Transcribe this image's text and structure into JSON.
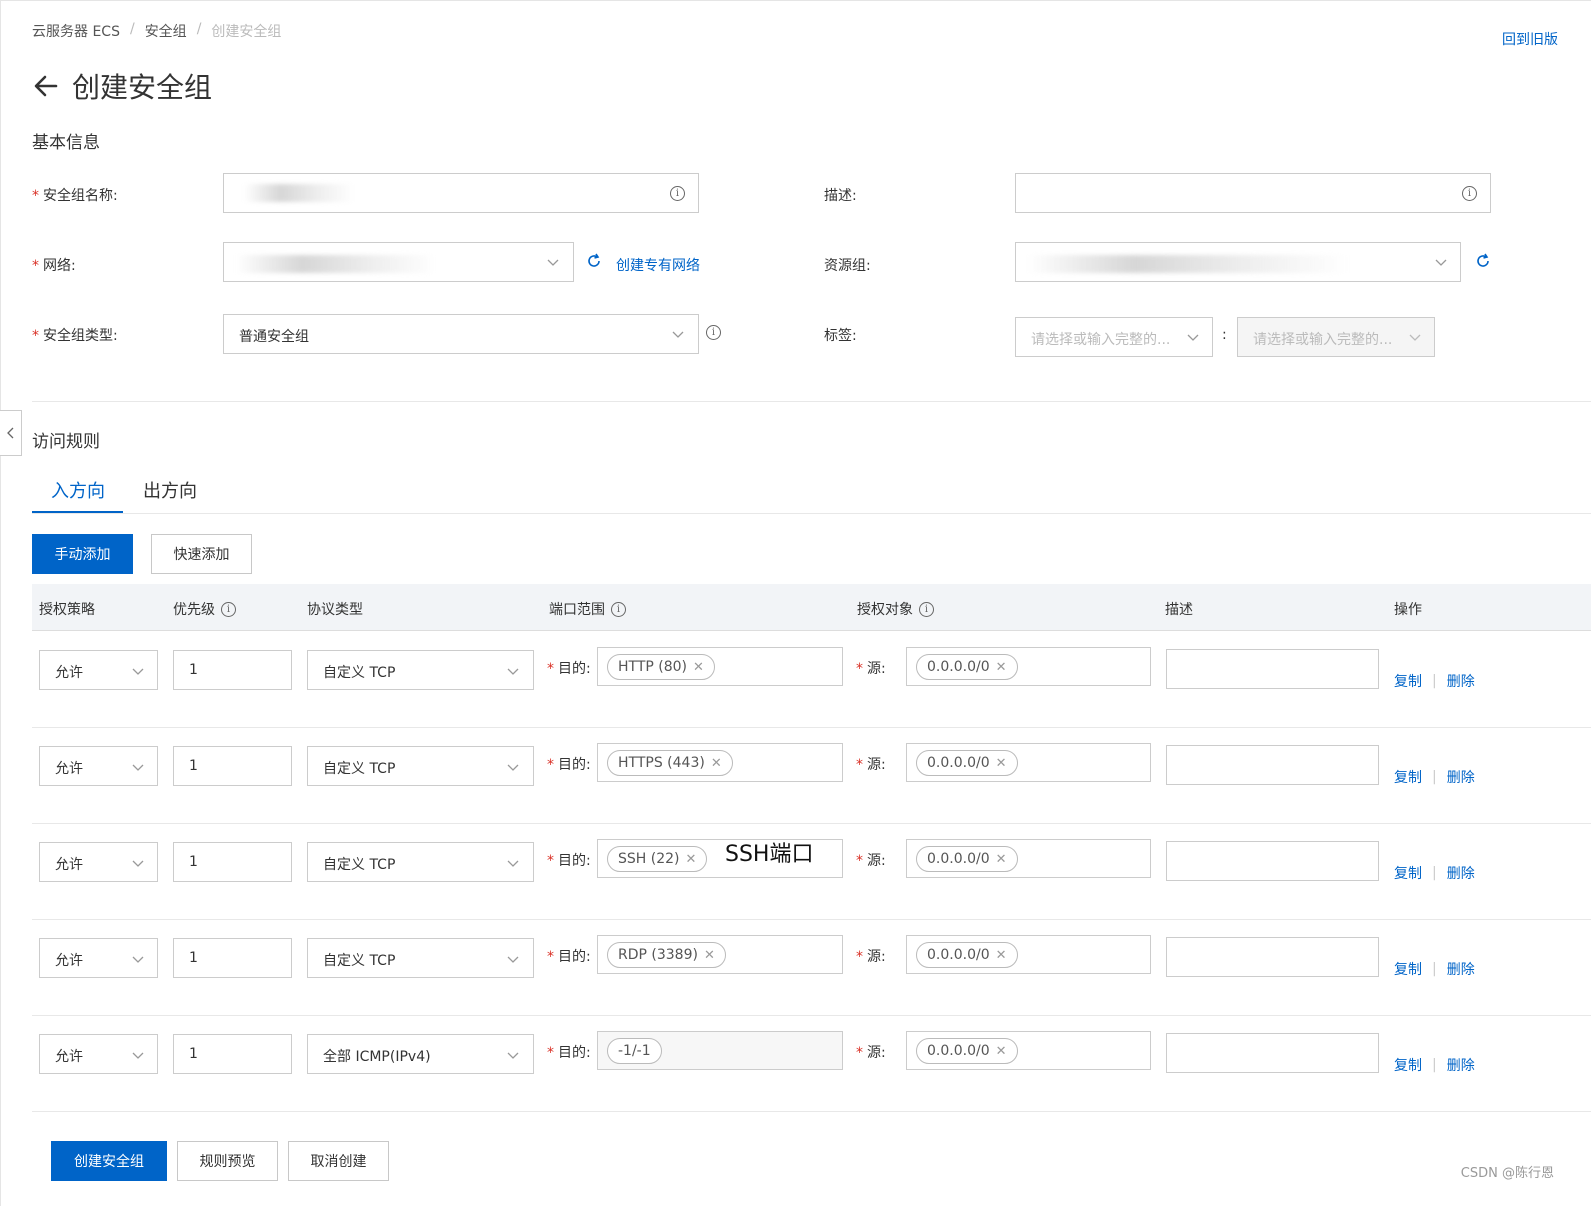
{
  "breadcrumb": {
    "item1": "云服务器 ECS",
    "item2": "安全组",
    "item3": "创建安全组",
    "sep": "/"
  },
  "old_version_link": "回到旧版",
  "page_title": "创建安全组",
  "basic_info": {
    "title": "基本信息",
    "name_label": "安全组名称:",
    "desc_label": "描述:",
    "network_label": "网络:",
    "create_vpc_link": "创建专有网络",
    "resource_group_label": "资源组:",
    "type_label": "安全组类型:",
    "type_value": "普通安全组",
    "tag_label": "标签:",
    "tag_key_placeholder": "请选择或输入完整的...",
    "tag_value_placeholder": "请选择或输入完整的...",
    "tag_sep": ":"
  },
  "access_rules": {
    "title": "访问规则",
    "tab_inbound": "入方向",
    "tab_outbound": "出方向",
    "manual_add": "手动添加",
    "quick_add": "快速添加",
    "columns": {
      "policy": "授权策略",
      "priority": "优先级",
      "protocol": "协议类型",
      "port_range": "端口范围",
      "auth_object": "授权对象",
      "description": "描述",
      "actions": "操作"
    },
    "dest_label": "目的:",
    "src_label": "源:",
    "copy": "复制",
    "delete": "删除",
    "rows": [
      {
        "policy": "允许",
        "priority": "1",
        "protocol": "自定义 TCP",
        "port": "HTTP (80)",
        "source": "0.0.0.0/0"
      },
      {
        "policy": "允许",
        "priority": "1",
        "protocol": "自定义 TCP",
        "port": "HTTPS (443)",
        "source": "0.0.0.0/0"
      },
      {
        "policy": "允许",
        "priority": "1",
        "protocol": "自定义 TCP",
        "port": "SSH (22)",
        "source": "0.0.0.0/0"
      },
      {
        "policy": "允许",
        "priority": "1",
        "protocol": "自定义 TCP",
        "port": "RDP (3389)",
        "source": "0.0.0.0/0"
      },
      {
        "policy": "允许",
        "priority": "1",
        "protocol": "全部 ICMP(IPv4)",
        "port": "-1/-1",
        "source": "0.0.0.0/0"
      }
    ]
  },
  "annotation": "SSH端口",
  "footer": {
    "create": "创建安全组",
    "preview": "规则预览",
    "cancel": "取消创建"
  },
  "watermark": "CSDN @陈行恩",
  "colors": {
    "primary": "#0064c8",
    "required": "#d93026"
  }
}
